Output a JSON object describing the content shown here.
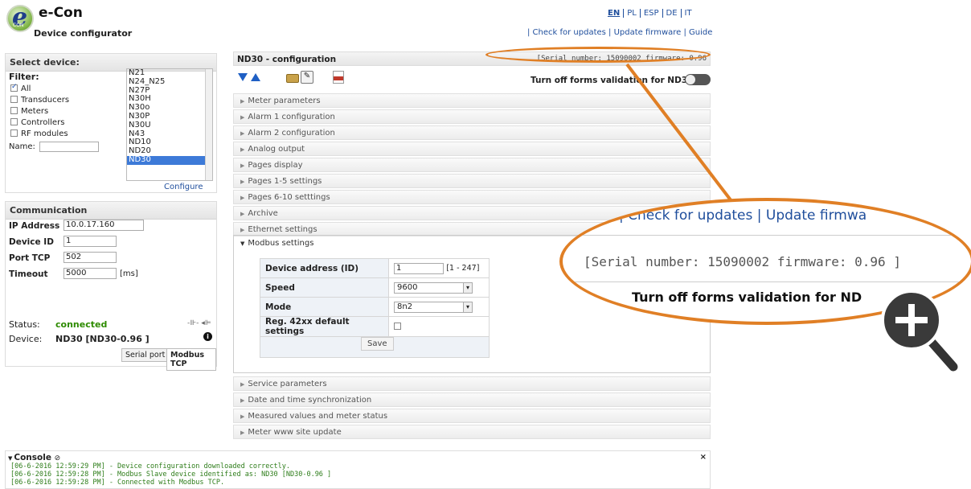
{
  "header": {
    "app_name": "e-Con",
    "subtitle": "Device configurator",
    "logo_letter": "e",
    "logo_sub": "CON",
    "languages": [
      "EN",
      "PL",
      "ESP",
      "DE",
      "IT"
    ],
    "top_links": "| Check for updates | Update firmware | Guide"
  },
  "select_device": {
    "title": "Select device:",
    "filter_label": "Filter:",
    "filters": [
      {
        "label": "All",
        "checked": true
      },
      {
        "label": "Transducers",
        "checked": false
      },
      {
        "label": "Meters",
        "checked": false
      },
      {
        "label": "Controllers",
        "checked": false
      },
      {
        "label": "RF modules",
        "checked": false
      }
    ],
    "name_label": "Name:",
    "devices": [
      "N21",
      "N24_N25",
      "N27P",
      "N30H",
      "N30o",
      "N30P",
      "N30U",
      "N43",
      "ND10",
      "ND20",
      "ND30"
    ],
    "selected_device": "ND30",
    "configure_link": "Configure"
  },
  "communication": {
    "title": "Communication",
    "ip_label": "IP Address",
    "ip_value": "10.0.17.160",
    "device_id_label": "Device ID",
    "device_id_value": "1",
    "port_label": "Port TCP",
    "port_value": "502",
    "timeout_label": "Timeout",
    "timeout_value": "5000",
    "timeout_unit": "[ms]",
    "status_label": "Status:",
    "status_value": "connected",
    "device_label": "Device:",
    "device_value": "ND30 [ND30-0.96 ]",
    "tab_serial": "Serial port",
    "tab_modbus": "Modbus TCP"
  },
  "config": {
    "title": "ND30 - configuration",
    "serial": "[Serial number: 15090002 firmware: 0.96",
    "validation_label": "Turn off forms validation for ND30",
    "sections_top": [
      "Meter parameters",
      "Alarm 1 configuration",
      "Alarm 2 configuration",
      "Analog output",
      "Pages display",
      "Pages 1-5 settings",
      "Pages 6-10 setttings",
      "Archive",
      "Ethernet settings"
    ],
    "modbus_title": "Modbus settings",
    "modbus": {
      "address_label": "Device address (ID)",
      "address_value": "1",
      "address_range": "[1 - 247]",
      "speed_label": "Speed",
      "speed_value": "9600",
      "mode_label": "Mode",
      "mode_value": "8n2",
      "reg_label": "Reg. 42xx default settings",
      "save_label": "Save"
    },
    "sections_bottom": [
      "Service parameters",
      "Date and time synchronization",
      "Measured values and meter status",
      "Meter www site update"
    ]
  },
  "console": {
    "title": "Console",
    "lines": [
      "[06-6-2016 12:59:29 PM] - Device configuration downloaded correctly.",
      "[06-6-2016 12:59:28 PM] - Modbus Slave device identified as: ND30 [ND30-0.96 ]",
      "[06-6-2016 12:59:28 PM] - Connected with Modbus TCP."
    ]
  },
  "magnifier": {
    "links": "| Check for updates | Update firmwa",
    "serial": "[Serial number: 15090002 firmware: 0.96 ]",
    "validation": "Turn off forms validation for ND"
  },
  "colors": {
    "accent": "#e07f25",
    "link": "#1f4e9c",
    "status_ok": "#2e8b00",
    "selection": "#3d7ad8"
  }
}
